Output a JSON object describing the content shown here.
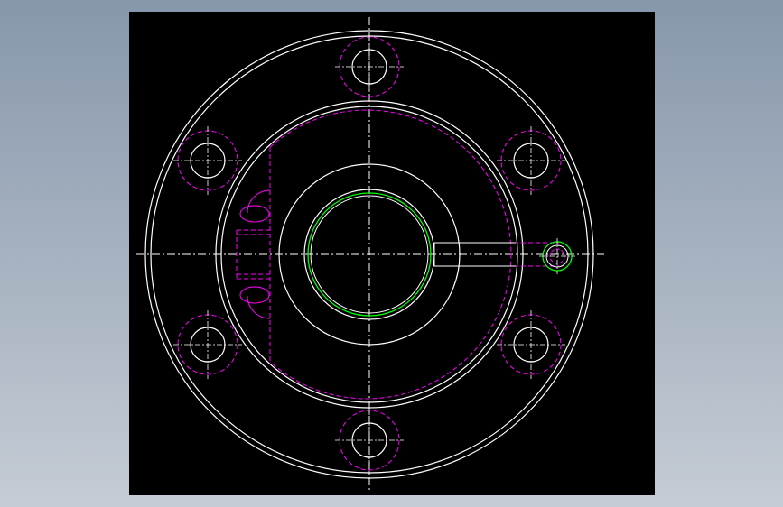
{
  "viewport": {
    "background_top": "#8797ab",
    "background_bottom": "#c5ccd5"
  },
  "canvas": {
    "background": "#000000"
  },
  "colors": {
    "visible_lines": "#ffffff",
    "hidden_lines": "#ff00ff",
    "thread_lines": "#00ff00",
    "center_lines": "#ffffff"
  },
  "drawing": {
    "type": "cad-flange-top-view",
    "bolt_hole_count": 6,
    "has_side_port": true,
    "has_hidden_features": true
  }
}
